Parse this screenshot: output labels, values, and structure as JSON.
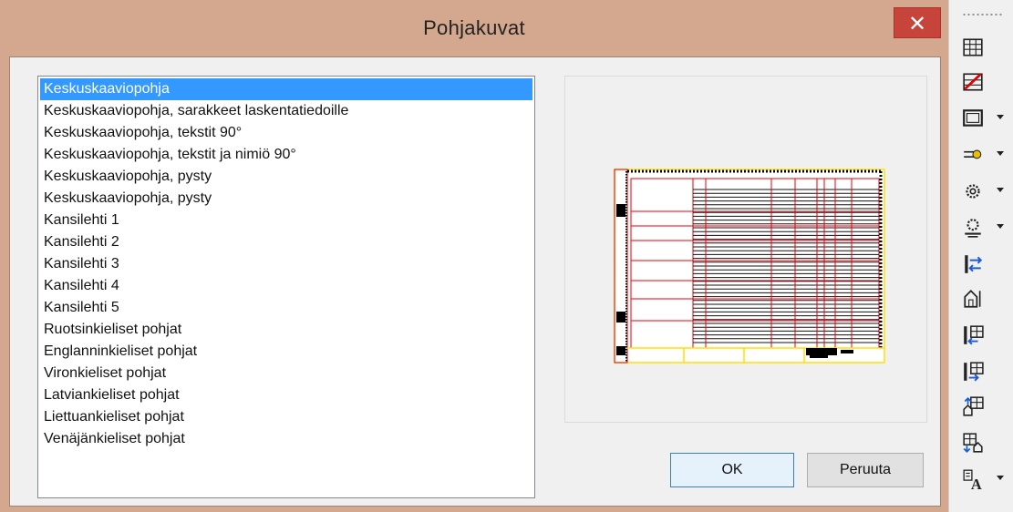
{
  "dialog": {
    "title": "Pohjakuvat",
    "close_label": "✕",
    "ok_label": "OK",
    "cancel_label": "Peruuta"
  },
  "templates": [
    "Keskuskaaviopohja",
    "Keskuskaaviopohja, sarakkeet laskentatiedoille",
    "Keskuskaaviopohja, tekstit 90°",
    "Keskuskaaviopohja, tekstit ja nimiö 90°",
    "Keskuskaaviopohja, pysty",
    "Keskuskaaviopohja, pysty",
    "Kansilehti 1",
    "Kansilehti 2",
    "Kansilehti 3",
    "Kansilehti 4",
    "Kansilehti 5",
    "Ruotsinkieliset pohjat",
    "Englanninkieliset pohjat",
    "Vironkieliset pohjat",
    "Latviankieliset pohjat",
    "Liettuankieliset pohjat",
    "Venäjänkieliset pohjat"
  ],
  "selected_index": 0,
  "toolbar": {
    "items": [
      {
        "icon": "table-grid-icon",
        "has_dropdown": false
      },
      {
        "icon": "table-delete-icon",
        "has_dropdown": false
      },
      {
        "icon": "frame-icon",
        "has_dropdown": true
      },
      {
        "icon": "connector-icon",
        "has_dropdown": true
      },
      {
        "icon": "gears-icon",
        "has_dropdown": true
      },
      {
        "icon": "gear-settings-icon",
        "has_dropdown": true
      },
      {
        "icon": "swap-arrows-icon",
        "has_dropdown": false
      },
      {
        "icon": "building-text-icon",
        "has_dropdown": false
      },
      {
        "icon": "table-insert-left-icon",
        "has_dropdown": false
      },
      {
        "icon": "table-insert-right-icon",
        "has_dropdown": false
      },
      {
        "icon": "table-building-up-icon",
        "has_dropdown": false
      },
      {
        "icon": "table-building-down-icon",
        "has_dropdown": false
      },
      {
        "icon": "text-style-icon",
        "has_dropdown": true
      }
    ]
  },
  "colors": {
    "frame_border": "#d4a88e",
    "selection": "#3399ff",
    "close_button": "#c7443b",
    "preview_red": "#e8000b",
    "preview_yellow": "#ffff00"
  }
}
